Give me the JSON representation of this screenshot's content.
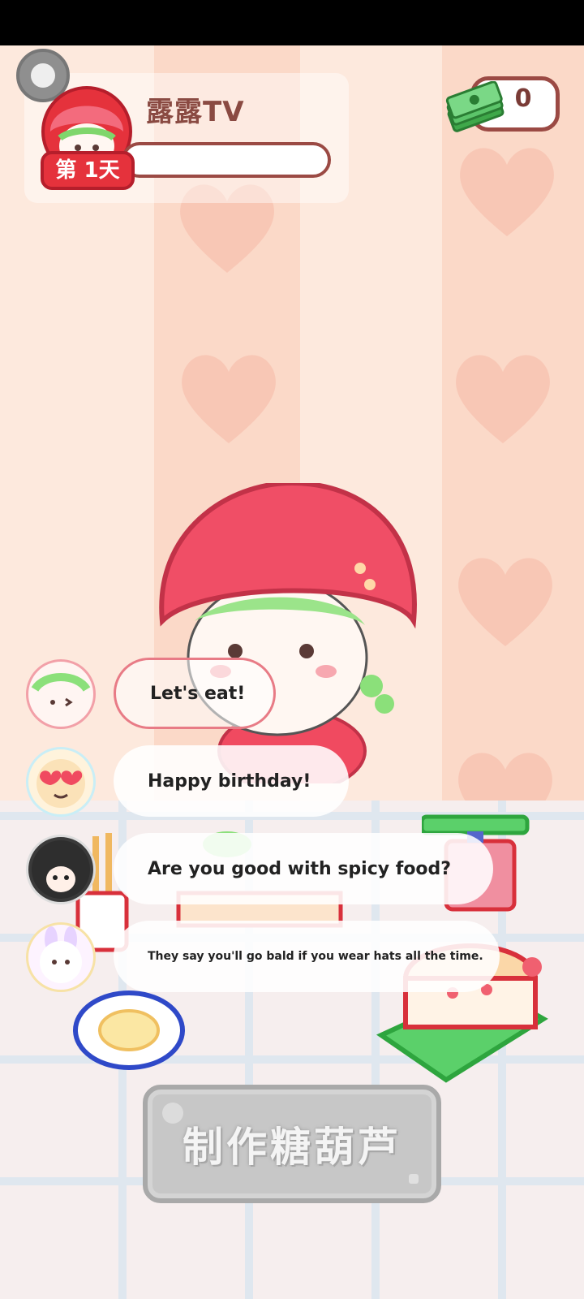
{
  "header": {
    "channel_name": "露露TV",
    "day_label": "第 1天",
    "money": "0"
  },
  "chat": [
    {
      "avatar": "chef-avatar",
      "text": "Let's eat!"
    },
    {
      "avatar": "heart-glasses-avatar",
      "text": "Happy birthday!"
    },
    {
      "avatar": "hooded-avatar",
      "text": "Are you good with spicy food?"
    },
    {
      "avatar": "bunny-avatar",
      "text": "They say you'll go bald if you wear hats all the time."
    }
  ],
  "actions": {
    "make_button_label": "制作糖葫芦"
  },
  "colors": {
    "accent_red": "#e5323c",
    "border_brown": "#9b4a44",
    "bubble_border": "#e87b86",
    "button_gray": "#c7c7c7"
  }
}
